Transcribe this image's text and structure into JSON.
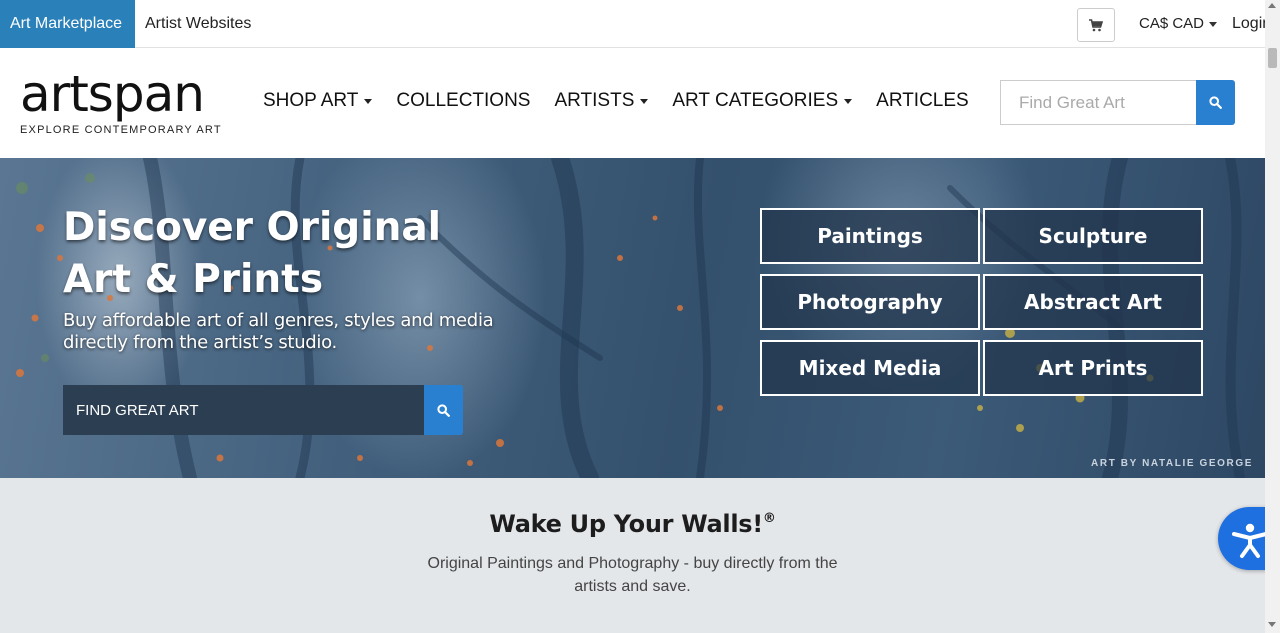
{
  "topbar": {
    "tabs": [
      {
        "label": "Art Marketplace",
        "active": true
      },
      {
        "label": "Artist Websites",
        "active": false
      }
    ],
    "cart_icon": "shopping-cart-icon",
    "currency": "CA$ CAD",
    "login": "Login",
    "accent_color": "#2a80b9"
  },
  "header": {
    "logo_word": "artspan",
    "logo_tagline": "EXPLORE CONTEMPORARY ART",
    "nav": [
      {
        "label": "SHOP ART",
        "dropdown": true
      },
      {
        "label": "COLLECTIONS",
        "dropdown": false
      },
      {
        "label": "ARTISTS",
        "dropdown": true
      },
      {
        "label": "ART CATEGORIES",
        "dropdown": true
      },
      {
        "label": "ARTICLES",
        "dropdown": false
      }
    ],
    "search_placeholder": "Find Great Art",
    "search_icon": "search-icon"
  },
  "hero": {
    "title_line1": "Discover Original",
    "title_line2": "Art & Prints",
    "subtitle": "Buy affordable art of all genres, styles and media directly from the artist’s studio.",
    "search_placeholder": "FIND GREAT ART",
    "categories": [
      "Paintings",
      "Sculpture",
      "Photography",
      "Abstract Art",
      "Mixed Media",
      "Art Prints"
    ],
    "credit": "ART BY NATALIE GEORGE"
  },
  "tagline": {
    "title": "Wake Up Your Walls!",
    "mark": "®",
    "subtitle": "Original Paintings and Photography - buy directly from the artists and save."
  },
  "accessibility": {
    "icon": "accessibility-icon",
    "color": "#1e6fe0"
  }
}
